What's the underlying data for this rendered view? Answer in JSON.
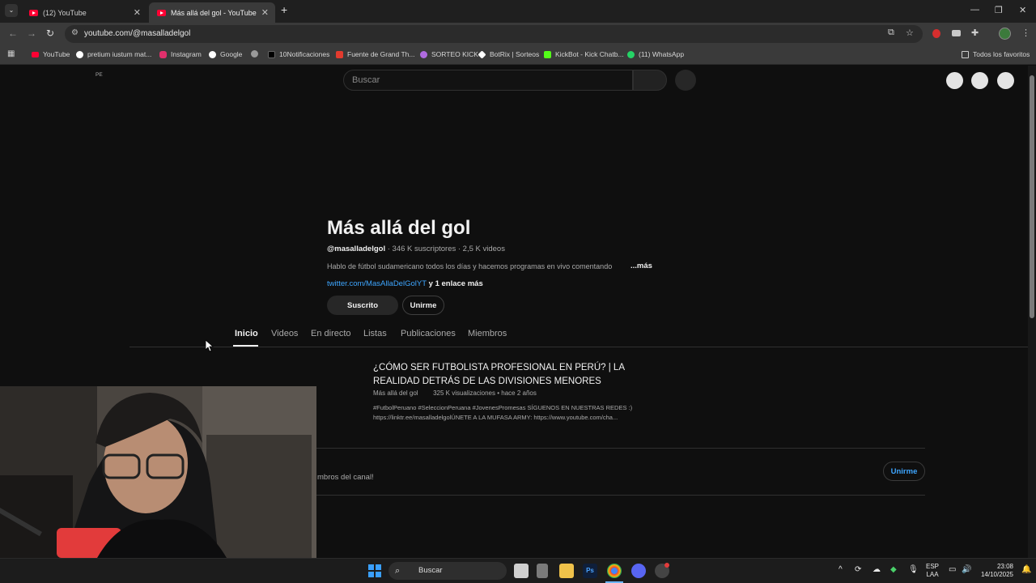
{
  "browser": {
    "tabs": [
      {
        "title": "(12) YouTube",
        "active": false
      },
      {
        "title": "Más allá del gol - YouTube",
        "active": true
      }
    ],
    "new_tab_symbol": "+",
    "url": "youtube.com/@masalladelgol",
    "window_controls": {
      "minimize": "—",
      "restore": "❐",
      "close": "✕"
    }
  },
  "bookmarks": [
    {
      "label": "YouTube",
      "icon": "youtube-icon",
      "color": "#ff0033"
    },
    {
      "label": "pretium iustum mat...",
      "icon": "google-icon",
      "color": "#ffffff"
    },
    {
      "label": "Instagram",
      "icon": "instagram-icon",
      "color": "#e1306c"
    },
    {
      "label": "Google",
      "icon": "google-icon",
      "color": "#ffffff"
    },
    {
      "label": "",
      "icon": "globe-icon",
      "color": "#9a9a9a"
    },
    {
      "label": "10Notificaciones",
      "icon": "x-icon",
      "color": "#000000"
    },
    {
      "label": "Fuente de Grand Th...",
      "icon": "fandom-icon",
      "color": "#e23b2e"
    },
    {
      "label": "SORTEO KICK",
      "icon": "kick-icon",
      "color": "#b06be0"
    },
    {
      "label": "BotRix | Sorteos",
      "icon": "botrix-icon",
      "color": "#ffffff"
    },
    {
      "label": "KickBot - Kick Chatb...",
      "icon": "kickbot-icon",
      "color": "#53fc18"
    },
    {
      "label": "(11) WhatsApp",
      "icon": "whatsapp-icon",
      "color": "#25d366"
    }
  ],
  "bookmarks_all": "Todos los favoritos",
  "youtube": {
    "country_code": "PE",
    "search_placeholder": "Buscar",
    "channel": {
      "name": "Más allá del gol",
      "handle": "@masalladelgol",
      "subscribers": " · 346 K suscriptores · 2,5 K videos",
      "description": "Hablo de fútbol sudamericano todos los días y hacemos programas en vivo comentando",
      "more": "...más",
      "link": "twitter.com/MasAllaDelGolYT",
      "link_extra": " y 1 enlace más",
      "subscribed_label": "Suscrito",
      "join_label": "Unirme"
    },
    "tabs": [
      "Inicio",
      "Videos",
      "En directo",
      "Listas",
      "Publicaciones",
      "Miembros"
    ],
    "featured_video": {
      "title": "¿CÓMO SER FUTBOLISTA PROFESIONAL EN PERÚ? | LA REALIDAD DETRÁS DE LAS DIVISIONES MENORES",
      "channel": "Más allá del gol",
      "views": "325 K visualizaciones",
      "age": "hace 2 años",
      "description": "#FutbolPeruano #SeleccionPeruana #JovenesPromesas SÍGUENOS EN NUESTRAS REDES :) https://linktr.ee/masalladelgolÚNETE A LA MUFASA ARMY: https://www.youtube.com/cha..."
    },
    "members_text": "mbros del canal!",
    "members_join_label": "Unirme"
  },
  "taskbar": {
    "search_label": "Buscar",
    "language": "ESP",
    "layout": "LAA",
    "time": "23:08",
    "date": "14/10/2025"
  }
}
